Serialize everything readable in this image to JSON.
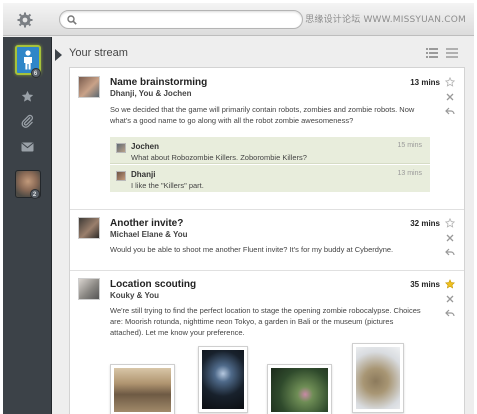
{
  "topbar": {
    "search_placeholder": "",
    "watermark": "思缘设计论坛 WWW.MISSYUAN.COM"
  },
  "rail": {
    "user_badge": "6",
    "avatar_badge": "2",
    "icons": [
      "gear-icon",
      "user-icon",
      "star-icon",
      "paperclip-icon",
      "mail-icon"
    ]
  },
  "stream": {
    "title": "Your stream",
    "posts": [
      {
        "title": "Name brainstorming",
        "people": "Dhanji, You & Jochen",
        "time": "13 mins",
        "body": "So we decided that the game will primarily contain robots, zombies and zombie robots. Now what's a good name to go along with all the robot zombie awesomeness?",
        "replies": [
          {
            "author": "Jochen",
            "time": "15 mins",
            "text": "What about Robozombie Killers. Zoborombie Killers?"
          },
          {
            "author": "Dhanji",
            "time": "13 mins",
            "text": "I like the \"Killers\" part."
          }
        ]
      },
      {
        "title": "Another invite?",
        "people": "Michael Elane & You",
        "time": "32 mins",
        "body": "Would you be able to shoot me another Fluent invite? It's for my buddy at Cyberdyne."
      },
      {
        "title": "Location scouting",
        "people": "Kouky & You",
        "time": "35 mins",
        "starred": true,
        "body": "We're still trying to find the perfect location to stage the opening zombie robocalypse. Choices are: Moorish rotunda, nighttime neon Tokyo, a garden in Bali or the museum (pictures attached). Let me know your preference."
      }
    ]
  },
  "colors": {
    "rail": "#3c4248",
    "accent_blue": "#2f86c8",
    "selection_green": "#a6c23a",
    "reply_bg": "#e8eddc",
    "star_gold": "#e8b400"
  }
}
